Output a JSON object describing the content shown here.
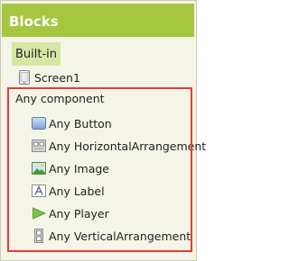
{
  "panel": {
    "title": "Blocks"
  },
  "builtin": {
    "label": "Built-in"
  },
  "screen": {
    "label": "Screen1",
    "icon": "screen-icon"
  },
  "any_component": {
    "heading": "Any component",
    "items": [
      {
        "label": "Any Button",
        "icon": "button-icon"
      },
      {
        "label": "Any HorizontalArrangement",
        "icon": "horizontal-arrangement-icon"
      },
      {
        "label": "Any Image",
        "icon": "image-icon"
      },
      {
        "label": "Any Label",
        "icon": "label-icon"
      },
      {
        "label": "Any Player",
        "icon": "player-icon"
      },
      {
        "label": "Any VerticalArrangement",
        "icon": "vertical-arrangement-icon"
      }
    ]
  },
  "colors": {
    "header_bg": "#a5c640",
    "panel_bg": "#f4f5e6",
    "builtin_bg": "#d6e6a4",
    "highlight_border": "#e83a3a"
  }
}
